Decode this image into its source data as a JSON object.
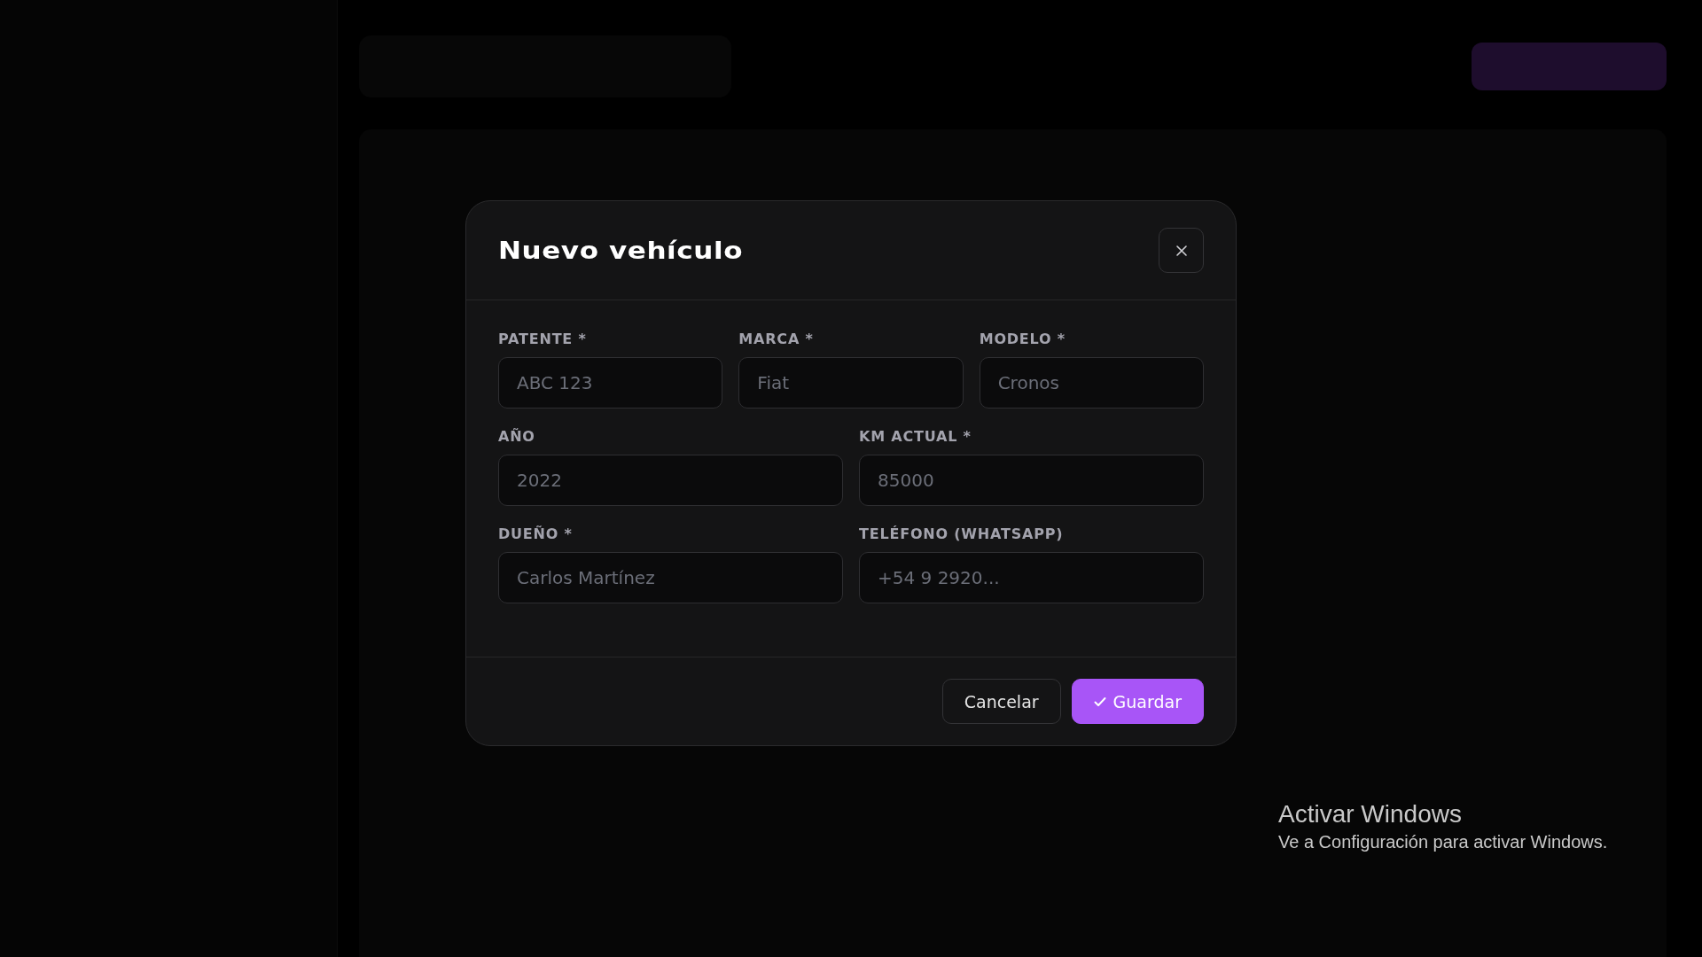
{
  "modal": {
    "title": "Nuevo vehículo",
    "rows": [
      [
        {
          "label": "PATENTE *",
          "placeholder": "ABC 123"
        },
        {
          "label": "MARCA *",
          "placeholder": "Fiat"
        },
        {
          "label": "MODELO *",
          "placeholder": "Cronos"
        }
      ],
      [
        {
          "label": "AÑO",
          "placeholder": "2022"
        },
        {
          "label": "KM ACTUAL *",
          "placeholder": "85000"
        }
      ],
      [
        {
          "label": "DUEÑO *",
          "placeholder": "Carlos Martínez"
        },
        {
          "label": "TELÉFONO (WHATSAPP)",
          "placeholder": "+54 9 2920..."
        }
      ]
    ],
    "buttons": [
      {
        "label": "Cancelar",
        "kind": "secondary"
      },
      {
        "label": "Guardar",
        "kind": "primary"
      }
    ]
  },
  "os_notice": {
    "title": "Activar Windows",
    "text": "Ve a Configuración para activar Windows."
  }
}
